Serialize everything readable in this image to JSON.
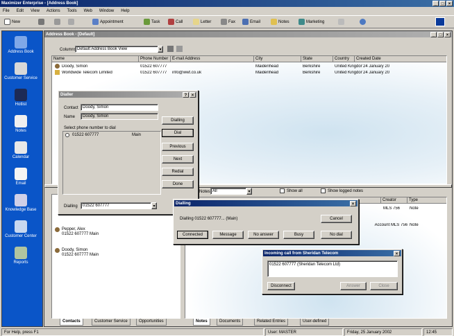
{
  "app": {
    "title": "Maximizer Enterprise - [Address Book]",
    "menu": [
      "File",
      "Edit",
      "View",
      "Actions",
      "Tools",
      "Web",
      "Window",
      "Help"
    ]
  },
  "toolbar": {
    "items": [
      "New",
      "Appointment",
      "Task",
      "Call",
      "Letter",
      "Fax",
      "Email",
      "Notes",
      "Marketing"
    ]
  },
  "sidebar": {
    "items": [
      "Address Book",
      "Customer Service",
      "Hotlist",
      "Notes",
      "Calendar",
      "Email",
      "Knowledge Base",
      "Customer Center",
      "Reports"
    ]
  },
  "addressbook": {
    "title": "Address Book - [Default]",
    "column_label": "Columns",
    "column_value": "Default Address Book View",
    "headers": [
      "Name",
      "Phone Number",
      "E-mail Address",
      "City",
      "State",
      "Country",
      "Created Date"
    ],
    "rows": [
      [
        "Doody, Simon",
        "01522 607777",
        "",
        "Maidenhead",
        "Berkshire",
        "United Kingdom",
        "24 January 20"
      ],
      [
        "Worldwide Telecom Limited",
        "01522 607777",
        "info@wwt.co.uk",
        "Maidenhead",
        "Berkshire",
        "United Kingdom",
        "24 January 20"
      ]
    ],
    "contacts": [
      {
        "name": "Pepper, Alex",
        "phone": "01522 607777 Main"
      },
      {
        "name": "Doody, Simon",
        "phone": "01522 607777 Main"
      }
    ],
    "tabs": [
      "Contacts",
      "Customer Service",
      "Opportunities"
    ]
  },
  "notes_pane": {
    "filter_label": "Notes",
    "filter_value": "All",
    "show_all": "Show all",
    "show_logged": "Show logged notes",
    "headers": [
      "",
      "Creator",
      "Type"
    ],
    "rows": [
      [
        "",
        "MLS 756",
        "Note"
      ],
      [
        "",
        "Account  MLS 756",
        "Note"
      ]
    ],
    "tabs": [
      "Notes",
      "Documents",
      "Related Entries",
      "User-defined"
    ]
  },
  "dial_dialog": {
    "title": "Dialler",
    "contact_label": "Contact",
    "contact_value": "Doody, Simon",
    "name_label": "Name",
    "name_value": "Doody, Simon",
    "select_label": "Select phone number to dial",
    "number": "01522 607777",
    "number_type": "Main",
    "dialing_label": "Dialling",
    "dialing_value": "01522 607777",
    "buttons": [
      "Dialling",
      "Dial",
      "Previous",
      "Next",
      "Redial",
      "Done"
    ]
  },
  "calling_dialog": {
    "title": "Dialling",
    "message": "Dialling 01522 607777... (Main)",
    "cancel": "Cancel",
    "buttons": [
      "Connected",
      "Message",
      "No answer",
      "Busy",
      "No dial"
    ]
  },
  "incoming_dialog": {
    "title": "Incoming call from  Sheridan Telecom",
    "caller": "01522 607777  (Sheridan Telecom Ltd)",
    "buttons": [
      "Disconnect",
      "Answer",
      "Close"
    ]
  },
  "statusbar": {
    "help": "For Help, press F1",
    "user": "User: MASTER",
    "date": "Friday, 25 January 2002",
    "time": "12:45"
  }
}
